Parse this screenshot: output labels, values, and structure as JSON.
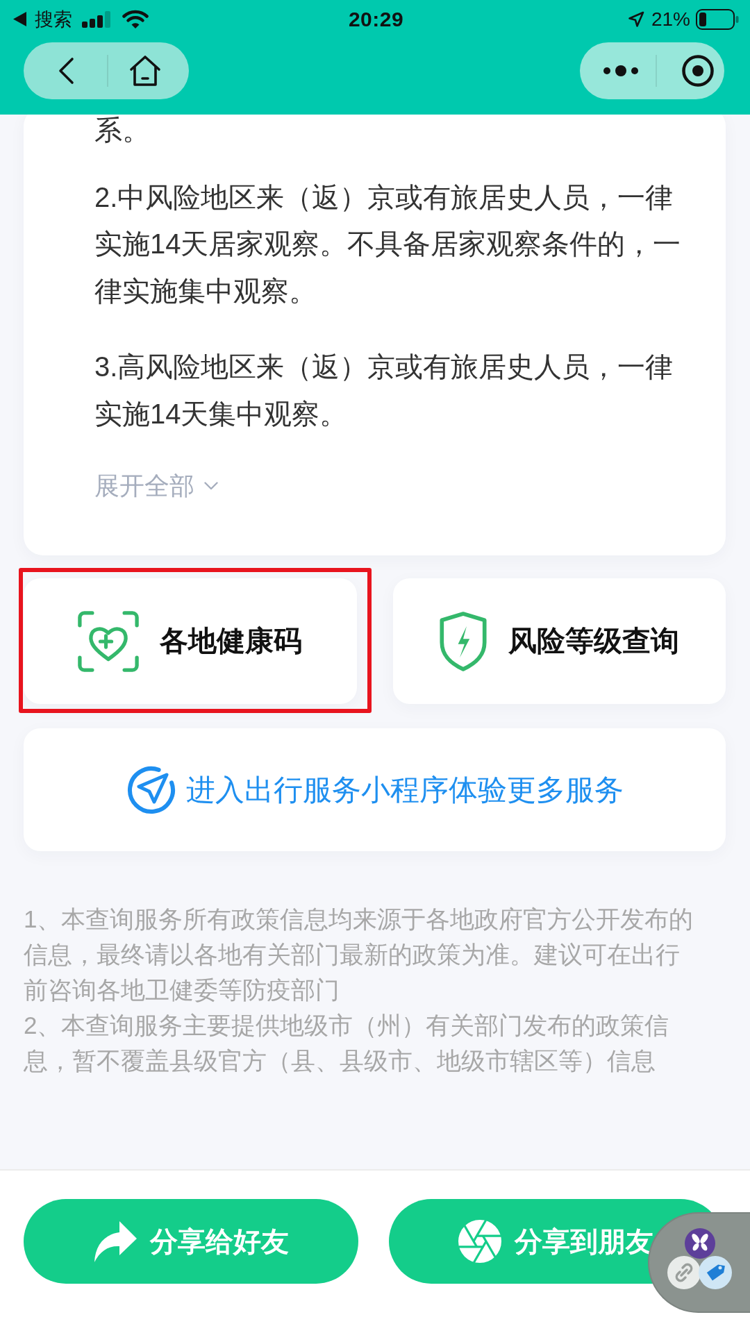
{
  "status_bar": {
    "back_label": "搜索",
    "time": "20:29",
    "battery": "21%"
  },
  "policy": {
    "paragraphs": [
      {
        "lines": [
          "系。"
        ]
      },
      {
        "lines": [
          "2.中风险地区来（返）京或有旅居史人员，一律",
          "实施14天居家观察。不具备居家观察条件的，一",
          "律实施集中观察。"
        ]
      },
      {
        "lines": [
          "3.高风险地区来（返）京或有旅居史人员，一律",
          "实施14天集中观察。"
        ]
      }
    ],
    "expand_label": "展开全部"
  },
  "tiles": [
    {
      "kind": "health_code",
      "label": "各地健康码",
      "highlighted": true
    },
    {
      "kind": "risk_level",
      "label": "风险等级查询",
      "highlighted": false
    }
  ],
  "service_link": {
    "label": "进入出行服务小程序体验更多服务"
  },
  "notes": [
    {
      "lines": [
        "1、本查询服务所有政策信息均来源于各地政府官方公开发布的",
        "信息，最终请以各地有关部门最新的政策为准。建议可在出行",
        "前咨询各地卫健委等防疫部门"
      ]
    },
    {
      "lines": [
        "2、本查询服务主要提供地级市（州）有关部门发布的政策信",
        "息，暂不覆盖县级官方（县、县级市、地级市辖区等）信息"
      ]
    }
  ],
  "share_buttons": [
    {
      "kind": "friends",
      "label": "分享给好友"
    },
    {
      "kind": "moments",
      "label": "分享到朋友"
    }
  ]
}
